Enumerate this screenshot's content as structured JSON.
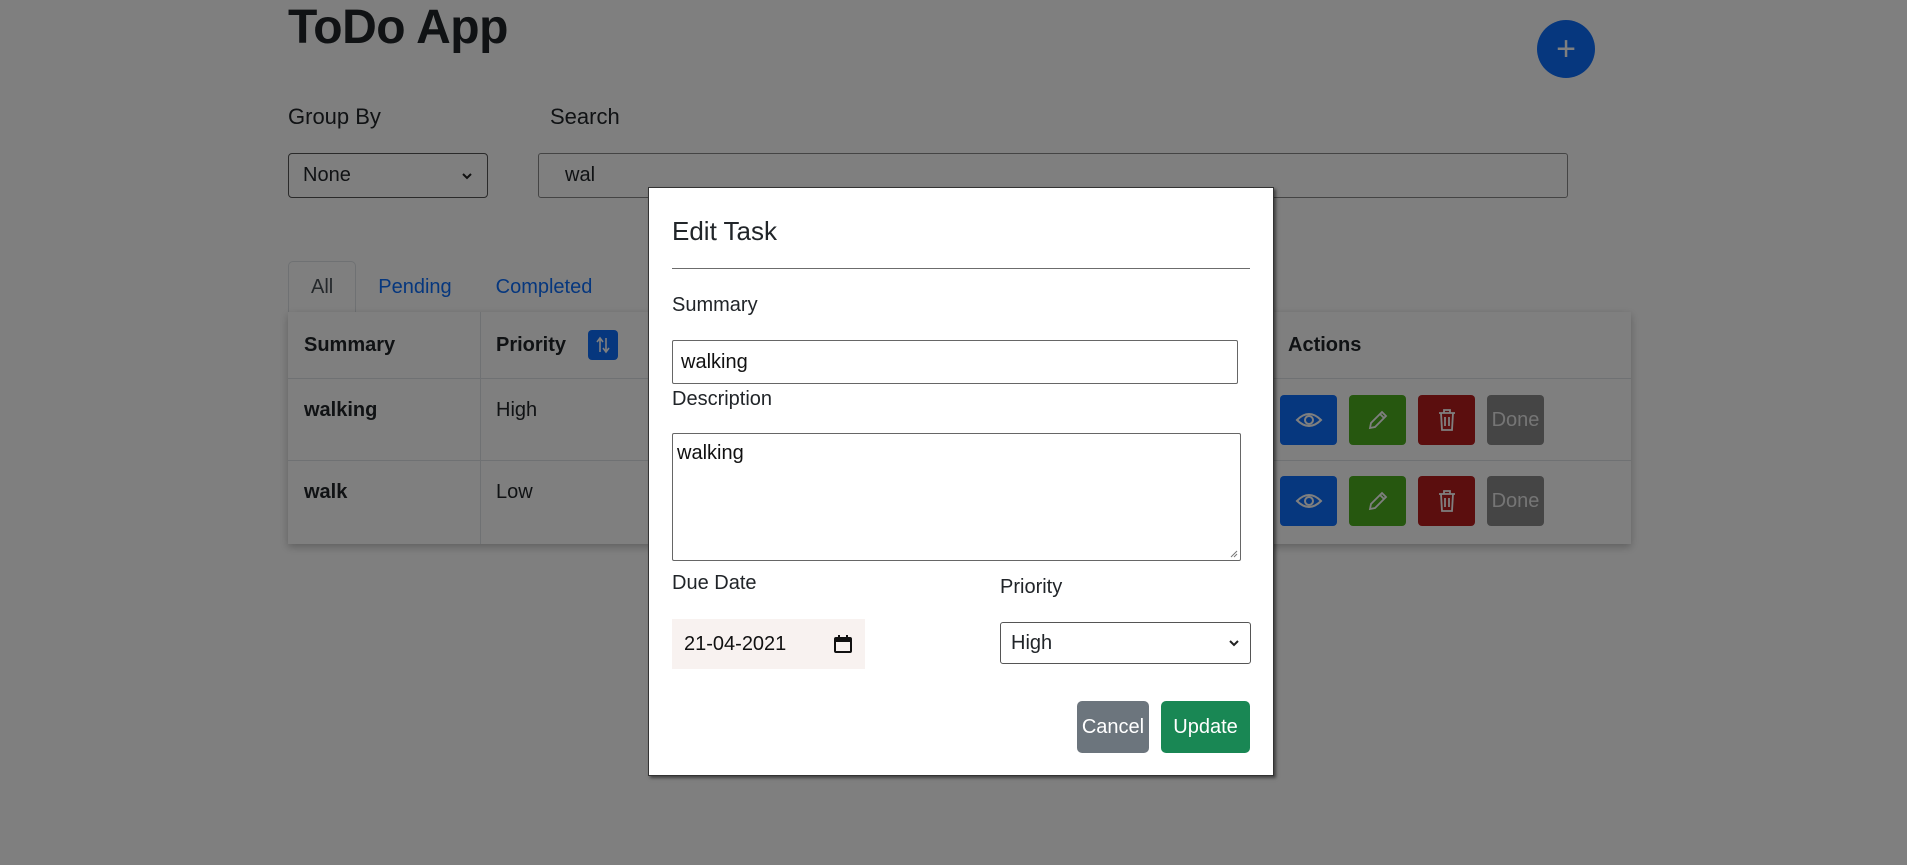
{
  "app": {
    "title": "ToDo App",
    "add_button": "+"
  },
  "filters": {
    "group_by_label": "Group By",
    "group_by_value": "None",
    "search_label": "Search",
    "search_value": "wal"
  },
  "tabs": [
    {
      "label": "All",
      "active": true
    },
    {
      "label": "Pending",
      "active": false
    },
    {
      "label": "Completed",
      "active": false
    }
  ],
  "table": {
    "headers": {
      "summary": "Summary",
      "priority": "Priority",
      "actions": "Actions"
    },
    "rows": [
      {
        "summary": "walking",
        "priority": "High"
      },
      {
        "summary": "walk",
        "priority": "Low"
      }
    ],
    "done_label": "Done"
  },
  "modal": {
    "title": "Edit Task",
    "summary_label": "Summary",
    "summary_value": "walking",
    "description_label": "Description",
    "description_value": "walking",
    "due_date_label": "Due Date",
    "due_date_value": "21-04-2021",
    "priority_label": "Priority",
    "priority_value": "High",
    "cancel_label": "Cancel",
    "update_label": "Update"
  },
  "colors": {
    "primary": "#0d6efd",
    "success": "#198754",
    "edit": "#4caf1e",
    "danger": "#b71c1c",
    "secondary": "#6c757d"
  },
  "icons": [
    "plus-icon",
    "sort-icon",
    "eye-icon",
    "pencil-icon",
    "trash-icon",
    "calendar-icon",
    "chevron-down-icon"
  ]
}
